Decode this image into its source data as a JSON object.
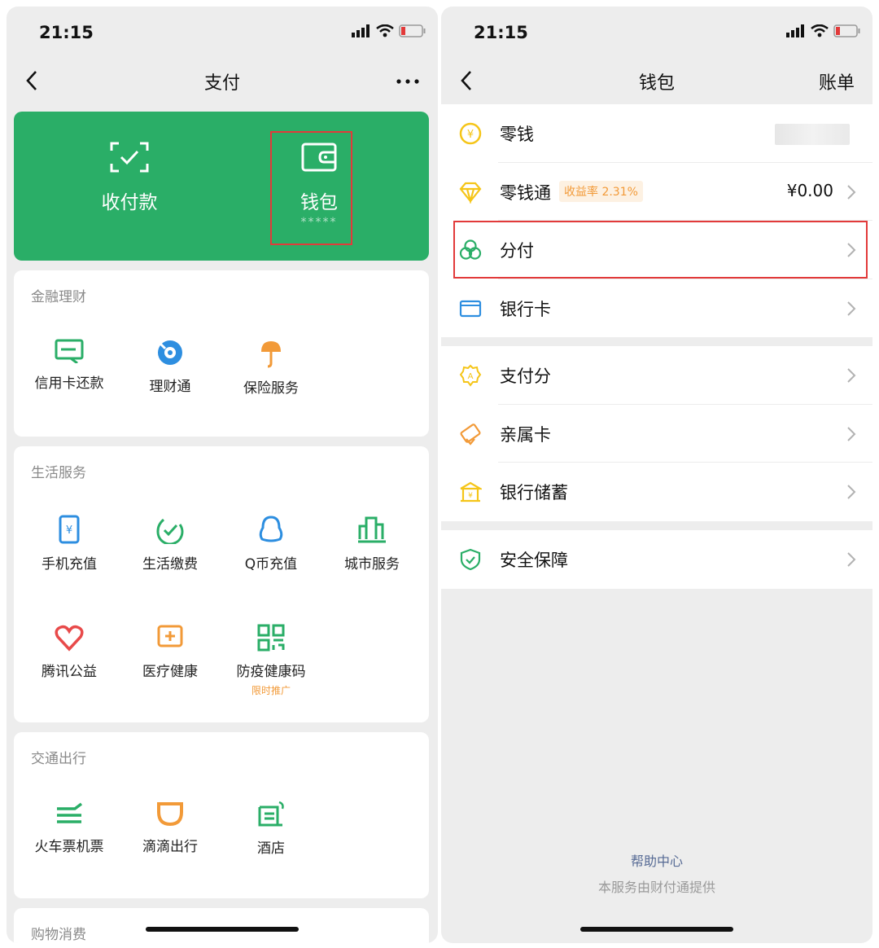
{
  "left": {
    "status_time": "21:15",
    "nav_title": "支付",
    "card": {
      "receive_pay": "收付款",
      "wallet": "钱包",
      "wallet_masked": "*****"
    },
    "sections": {
      "finance": {
        "title": "金融理财",
        "items": [
          "信用卡还款",
          "理财通",
          "保险服务"
        ]
      },
      "life": {
        "title": "生活服务",
        "items": [
          "手机充值",
          "生活缴费",
          "Q币充值",
          "城市服务",
          "腾讯公益",
          "医疗健康",
          "防疫健康码"
        ],
        "promo_label": "限时推广"
      },
      "transport": {
        "title": "交通出行",
        "items": [
          "火车票机票",
          "滴滴出行",
          "酒店"
        ]
      },
      "shopping": {
        "title": "购物消费"
      }
    }
  },
  "right": {
    "status_time": "21:15",
    "nav_title": "钱包",
    "nav_action": "账单",
    "rows": {
      "change": "零钱",
      "change_plus": "零钱通",
      "change_plus_badge": "收益率 2.31%",
      "change_plus_value": "¥0.00",
      "fenfu": "分付",
      "bank_card": "银行卡",
      "pay_score": "支付分",
      "family_card": "亲属卡",
      "bank_savings": "银行储蓄",
      "security": "安全保障"
    },
    "footer": {
      "help": "帮助中心",
      "provider": "本服务由财付通提供"
    }
  },
  "colors": {
    "brand_green": "#2aae67",
    "highlight_red": "#e23a3a",
    "promo_orange": "#f29a38",
    "link_blue": "#576b95"
  }
}
